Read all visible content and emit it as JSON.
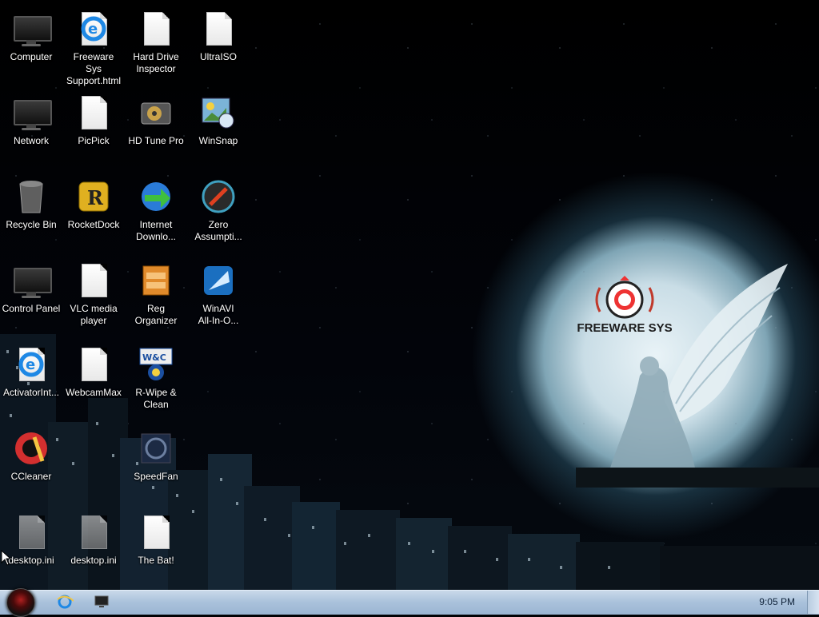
{
  "desktop": {
    "icons": [
      {
        "label": "Computer"
      },
      {
        "label": "Freeware Sys\nSupport.html"
      },
      {
        "label": "Hard Drive\nInspector"
      },
      {
        "label": "UltraISO"
      },
      {
        "label": "Network"
      },
      {
        "label": "PicPick"
      },
      {
        "label": "HD Tune Pro"
      },
      {
        "label": "WinSnap"
      },
      {
        "label": "Recycle Bin"
      },
      {
        "label": "RocketDock"
      },
      {
        "label": "Internet\nDownlo..."
      },
      {
        "label": "Zero\nAssumpti..."
      },
      {
        "label": "Control Panel"
      },
      {
        "label": "VLC media\nplayer"
      },
      {
        "label": "Reg Organizer"
      },
      {
        "label": "WinAVI\nAll-In-O..."
      },
      {
        "label": "ActivatorInt..."
      },
      {
        "label": "WebcamMax"
      },
      {
        "label": "R-Wipe &\nClean"
      },
      {
        "label": "CCleaner"
      },
      {
        "label": "SpeedFan"
      },
      {
        "label": "desktop.ini"
      },
      {
        "label": "desktop.ini"
      },
      {
        "label": "The Bat!"
      }
    ],
    "wallpaper_logo": "FREEWARE SYS"
  },
  "taskbar": {
    "clock": "9:05 PM",
    "pinned": [
      "internet-explorer-icon",
      "computer-icon"
    ]
  },
  "colors": {
    "taskbar": "#a9c1db",
    "moon": "#c9dde6",
    "logo_red": "#c0392b"
  }
}
